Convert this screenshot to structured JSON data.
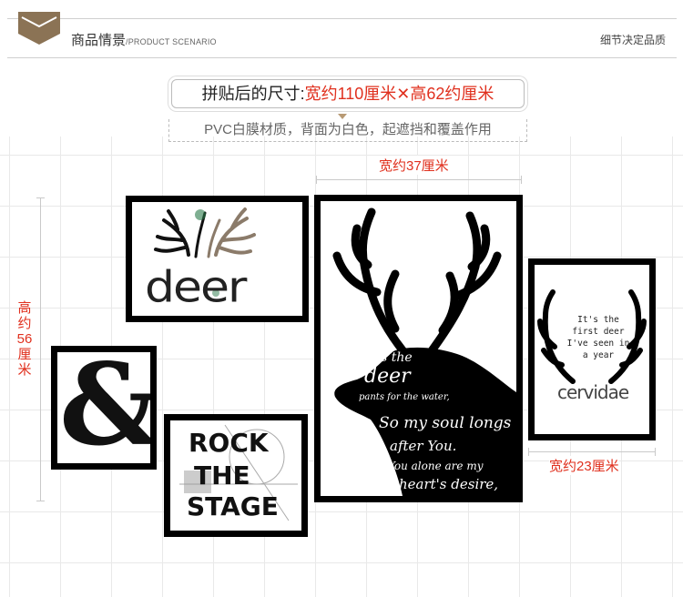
{
  "header": {
    "title": "商品情景",
    "subtitle": "/PRODUCT SCENARIO",
    "right_text": "细节决定品质"
  },
  "size_info": {
    "label": "拼贴后的尺寸:",
    "value": "宽约110厘米✕高62约厘米",
    "note": "PVC白膜材质，背面为白色，起遮挡和覆盖作用"
  },
  "dimensions": {
    "width_center": "宽约37厘米",
    "height_left": "高约56厘米",
    "width_right": "宽约23厘米"
  },
  "artworks": {
    "deer_word": "deer",
    "rock_line1": "ROCK",
    "rock_line2": "THE",
    "rock_line3": "STAGE",
    "ampersand": "&",
    "verse_line1": "As the",
    "verse_line2": "deer",
    "verse_line3": "pants for the water,",
    "verse_line4": "So my soul longs",
    "verse_line5": "after You.",
    "verse_line6": "You alone are my",
    "verse_line7": "heart's desire,",
    "quote": "It's the first deer I've seen in a year",
    "cervidae": "cervidae"
  },
  "colors": {
    "accent_red": "#e0301e",
    "badge_brown": "#8b7355",
    "frame_black": "#000000"
  }
}
